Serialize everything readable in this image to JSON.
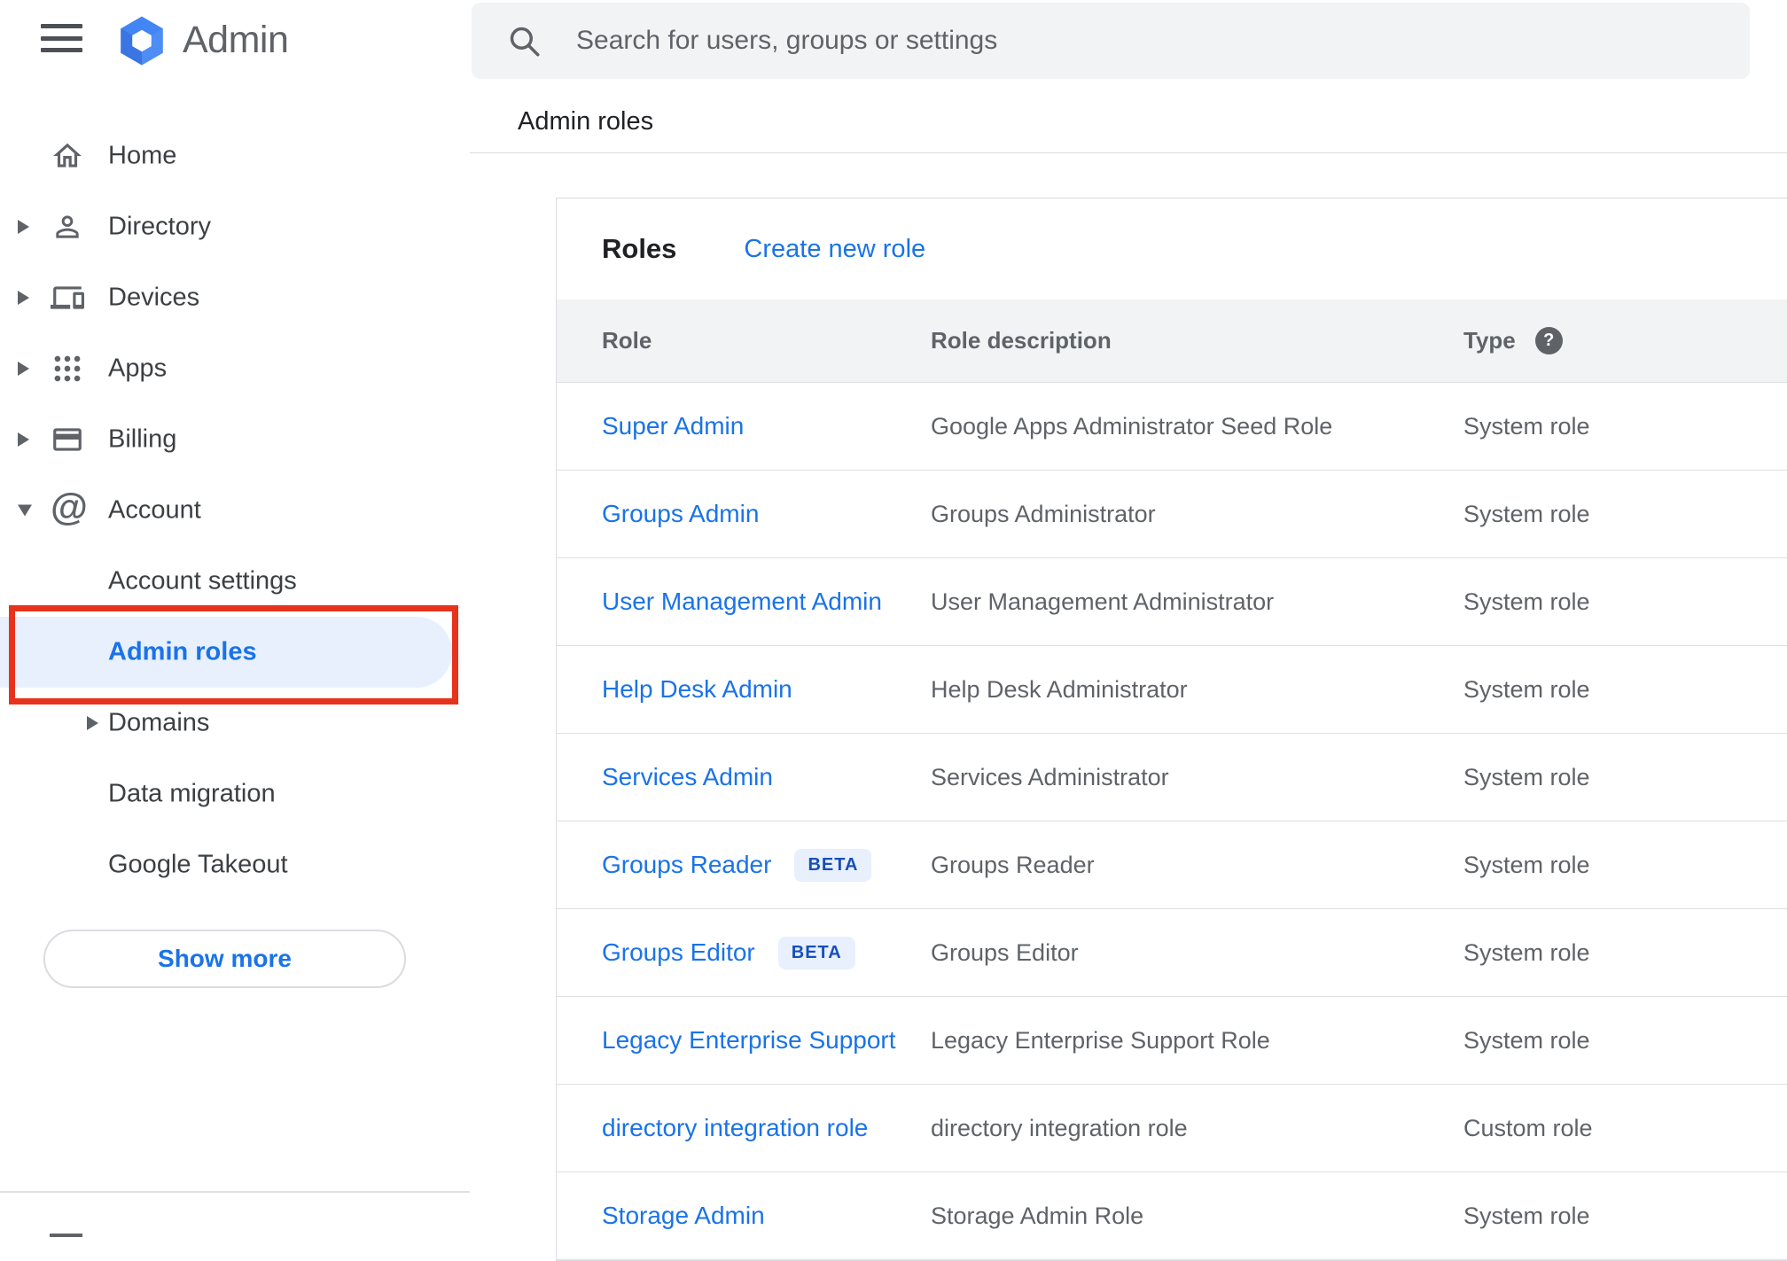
{
  "colors": {
    "link_blue": "#1a73e8",
    "selected_bg": "#e8f0fe",
    "annotation_red": "#e8331c",
    "beta_bg": "#e8f0fe",
    "beta_text": "#174fb8",
    "header_bg": "#f1f3f4",
    "searchbar_bg": "#f1f3f4",
    "logo_blue": "#4285f4",
    "text_primary": "#202124",
    "text_secondary": "#5f6368"
  },
  "app": {
    "title": "Admin"
  },
  "search": {
    "placeholder": "Search for users, groups or settings"
  },
  "breadcrumb": "Admin roles",
  "sidebar": {
    "items": [
      {
        "label": "Home",
        "icon": "home-icon",
        "expand": "none"
      },
      {
        "label": "Directory",
        "icon": "directory-icon",
        "expand": "collapsed"
      },
      {
        "label": "Devices",
        "icon": "devices-icon",
        "expand": "collapsed"
      },
      {
        "label": "Apps",
        "icon": "apps-icon",
        "expand": "collapsed"
      },
      {
        "label": "Billing",
        "icon": "billing-icon",
        "expand": "collapsed"
      },
      {
        "label": "Account",
        "icon": "account-icon",
        "expand": "expanded"
      },
      {
        "label": "Account settings",
        "sub": true
      },
      {
        "label": "Admin roles",
        "sub": true,
        "selected": true
      },
      {
        "label": "Domains",
        "sub": true,
        "expand": "collapsed"
      },
      {
        "label": "Data migration",
        "sub": true
      },
      {
        "label": "Google Takeout",
        "sub": true
      }
    ],
    "show_more_label": "Show more"
  },
  "main": {
    "card_title": "Roles",
    "create_link_label": "Create new role",
    "table": {
      "columns": [
        "Role",
        "Role description",
        "Type"
      ],
      "rows": [
        {
          "role": "Super Admin",
          "badge": null,
          "description": "Google Apps Administrator Seed Role",
          "type": "System role"
        },
        {
          "role": "Groups Admin",
          "badge": null,
          "description": "Groups Administrator",
          "type": "System role"
        },
        {
          "role": "User Management Admin",
          "badge": null,
          "description": "User Management Administrator",
          "type": "System role"
        },
        {
          "role": "Help Desk Admin",
          "badge": null,
          "description": "Help Desk Administrator",
          "type": "System role"
        },
        {
          "role": "Services Admin",
          "badge": null,
          "description": "Services Administrator",
          "type": "System role"
        },
        {
          "role": "Groups Reader",
          "badge": "BETA",
          "description": "Groups Reader",
          "type": "System role"
        },
        {
          "role": "Groups Editor",
          "badge": "BETA",
          "description": "Groups Editor",
          "type": "System role"
        },
        {
          "role": "Legacy Enterprise Support",
          "badge": null,
          "description": "Legacy Enterprise Support Role",
          "type": "System role"
        },
        {
          "role": "directory integration role",
          "badge": null,
          "description": "directory integration role",
          "type": "Custom role"
        },
        {
          "role": "Storage Admin",
          "badge": null,
          "description": "Storage Admin Role",
          "type": "System role"
        }
      ]
    }
  }
}
